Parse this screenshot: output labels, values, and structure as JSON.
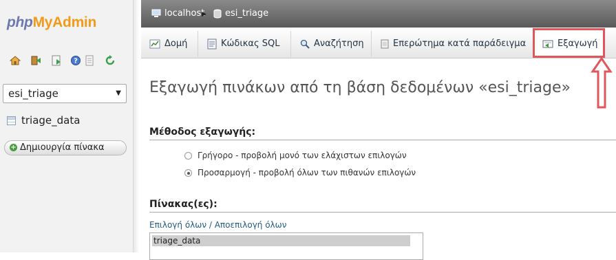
{
  "sidebar": {
    "logo": {
      "php": "php",
      "my": "My",
      "admin": "Admin"
    },
    "nav_icons": [
      "home-icon",
      "logout-icon",
      "sql-query-icon",
      "help-icon",
      "documentation-icon",
      "reload-icon"
    ],
    "database_select": {
      "value": "esi_triage"
    },
    "tables": [
      {
        "name": "triage_data"
      }
    ],
    "create_table_label": "Δημιουργία πίνακα"
  },
  "breadcrumb": {
    "server": "localhost",
    "database": "esi_triage"
  },
  "tabs": [
    {
      "label": "Δομή",
      "icon": "structure-icon",
      "active": false
    },
    {
      "label": "Κώδικας SQL",
      "icon": "sql-icon",
      "active": false
    },
    {
      "label": "Αναζήτηση",
      "icon": "search-icon",
      "active": false
    },
    {
      "label": "Επερώτημα κατά παράδειγμα",
      "icon": "query-icon",
      "active": false
    },
    {
      "label": "Εξαγωγή",
      "icon": "export-icon",
      "active": true
    }
  ],
  "main": {
    "title": "Εξαγωγή πινάκων από τη βάση δεδομένων «esi_triage»",
    "export_method": {
      "heading": "Μέθοδος εξαγωγής:",
      "options": [
        {
          "label": "Γρήγορο - προβολή μονό των ελάχιστων επιλογών",
          "checked": false
        },
        {
          "label": "Προσαρμογή - προβολή όλων των πιθανών επιλογών",
          "checked": true
        }
      ]
    },
    "tables_section": {
      "heading": "Πίνακας(ες):",
      "select_all": "Επιλογή όλων",
      "separator": " / ",
      "deselect_all": "Αποεπιλογή όλων",
      "items": [
        "triage_data"
      ]
    }
  },
  "colors": {
    "highlight": "#e0565b",
    "topbar": "#6e6e6e",
    "link": "#235a81"
  }
}
